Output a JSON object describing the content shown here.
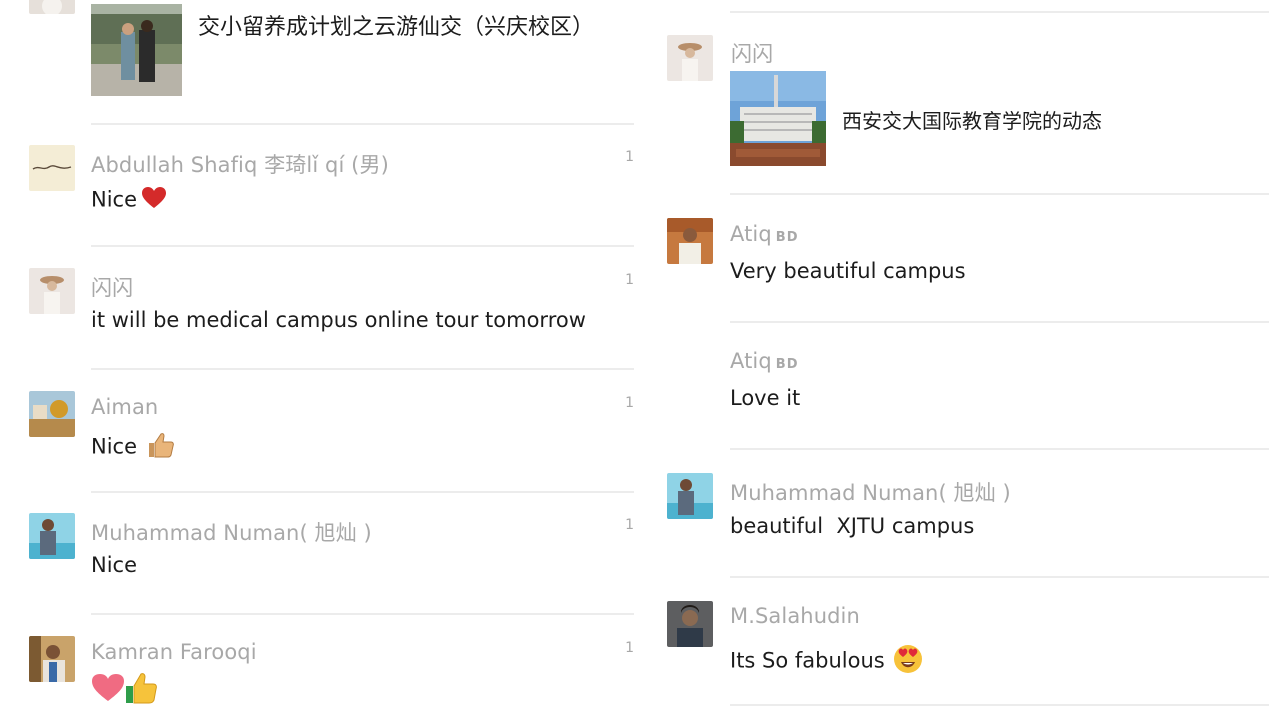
{
  "left": {
    "post": {
      "title": "交小留养成计划之云游仙交（兴庆校区）"
    },
    "comments": [
      {
        "name": "Abdullah Shafiq 李琦lǐ qí (男)",
        "text": "Nice",
        "count": "1",
        "emoji": "heart"
      },
      {
        "name": "闪闪",
        "text": "it will be medical campus online tour tomorrow",
        "count": "1"
      },
      {
        "name": "Aiman",
        "text": "Nice",
        "count": "1",
        "emoji": "thumbs-up"
      },
      {
        "name": "Muhammad Numan( 旭灿 )",
        "text": "Nice",
        "count": "1"
      },
      {
        "name": "Kamran Farooqi",
        "text": "",
        "count": "1",
        "emoji": "heart thumbs-up"
      }
    ]
  },
  "right": {
    "post": {
      "author": "闪闪",
      "title": "西安交大国际教育学院的动态"
    },
    "comments": [
      {
        "name": "Atiq",
        "badge": "BD",
        "text": "Very beautiful campus"
      },
      {
        "name": "Atiq",
        "badge": "BD",
        "text": "Love it"
      },
      {
        "name": "Muhammad Numan( 旭灿 )",
        "text": "beautiful  XJTU campus"
      },
      {
        "name": "M.Salahudin",
        "text": "Its So fabulous",
        "emoji": "heart-eyes"
      }
    ]
  }
}
